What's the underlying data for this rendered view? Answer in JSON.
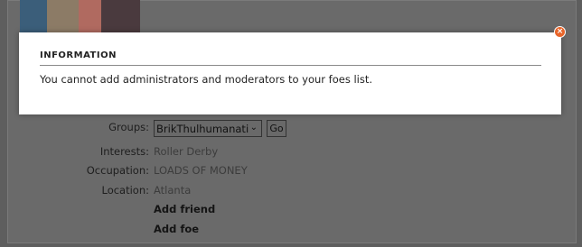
{
  "modal": {
    "title": "INFORMATION",
    "message": "You cannot add administrators and moderators to your foes list.",
    "close_icon": "close-icon"
  },
  "profile": {
    "groups": {
      "label": "Groups:",
      "selected": "BrikThulhumanati",
      "go_label": "Go"
    },
    "interests": {
      "label": "Interests:",
      "value": "Roller Derby"
    },
    "occupation": {
      "label": "Occupation:",
      "value": "LOADS OF MONEY"
    },
    "location": {
      "label": "Location:",
      "value": "Atlanta"
    },
    "add_friend": "Add friend",
    "add_foe": "Add foe"
  },
  "colors": {
    "accent_close": "#e8652a",
    "overlay": "#5e5e5e"
  }
}
